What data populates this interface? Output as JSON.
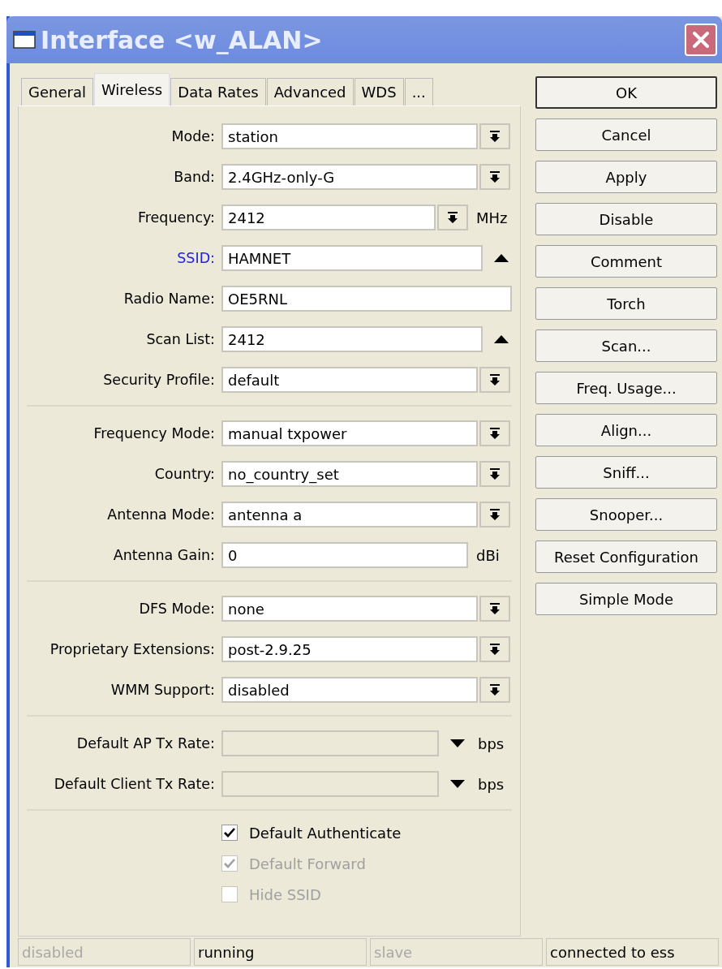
{
  "window": {
    "title": "Interface <w_ALAN>"
  },
  "tabs": [
    {
      "label": "General",
      "selected": false
    },
    {
      "label": "Wireless",
      "selected": true
    },
    {
      "label": "Data Rates",
      "selected": false
    },
    {
      "label": "Advanced",
      "selected": false
    },
    {
      "label": "WDS",
      "selected": false
    },
    {
      "label": "...",
      "selected": false
    }
  ],
  "sections": [
    {
      "fields": [
        {
          "label": "Mode:",
          "value": "station",
          "kind": "dropdown",
          "highlighted": false
        },
        {
          "label": "Band:",
          "value": "2.4GHz-only-G",
          "kind": "dropdown",
          "highlighted": false
        },
        {
          "label": "Frequency:",
          "value": "2412",
          "kind": "dropdown",
          "unit": "MHz",
          "highlighted": false
        },
        {
          "label": "SSID:",
          "value": "HAMNET",
          "kind": "list",
          "highlighted": true
        },
        {
          "label": "Radio Name:",
          "value": "OE5RNL",
          "kind": "text",
          "highlighted": false
        },
        {
          "label": "Scan List:",
          "value": "2412",
          "kind": "list",
          "highlighted": false
        },
        {
          "label": "Security Profile:",
          "value": "default",
          "kind": "dropdown",
          "highlighted": false
        }
      ]
    },
    {
      "fields": [
        {
          "label": "Frequency Mode:",
          "value": "manual txpower",
          "kind": "dropdown",
          "highlighted": false
        },
        {
          "label": "Country:",
          "value": "no_country_set",
          "kind": "dropdown",
          "highlighted": false
        },
        {
          "label": "Antenna Mode:",
          "value": "antenna a",
          "kind": "dropdown",
          "highlighted": false
        },
        {
          "label": "Antenna Gain:",
          "value": "0",
          "kind": "text",
          "unit": "dBi",
          "highlighted": false
        }
      ]
    },
    {
      "fields": [
        {
          "label": "DFS Mode:",
          "value": "none",
          "kind": "dropdown",
          "highlighted": false
        },
        {
          "label": "Proprietary Extensions:",
          "value": "post-2.9.25",
          "kind": "dropdown",
          "highlighted": false
        },
        {
          "label": "WMM Support:",
          "value": "disabled",
          "kind": "dropdown",
          "highlighted": false
        }
      ]
    },
    {
      "fields": [
        {
          "label": "Default AP Tx Rate:",
          "kind": "rate",
          "unit": "bps",
          "highlighted": false
        },
        {
          "label": "Default Client Tx Rate:",
          "kind": "rate",
          "unit": "bps",
          "highlighted": false
        }
      ]
    }
  ],
  "checkboxes": [
    {
      "label": "Default Authenticate",
      "checked": true,
      "disabled": false
    },
    {
      "label": "Default Forward",
      "checked": true,
      "disabled": true
    },
    {
      "label": "Hide SSID",
      "checked": false,
      "disabled": true
    }
  ],
  "button_groups": [
    {
      "buttons": [
        {
          "label": "OK",
          "default": true
        },
        {
          "label": "Cancel",
          "default": false
        },
        {
          "label": "Apply",
          "default": false
        }
      ]
    },
    {
      "buttons": [
        {
          "label": "Disable",
          "default": false
        },
        {
          "label": "Comment",
          "default": false
        }
      ]
    },
    {
      "buttons": [
        {
          "label": "Torch",
          "default": false
        },
        {
          "label": "Scan...",
          "default": false
        },
        {
          "label": "Freq. Usage...",
          "default": false
        },
        {
          "label": "Align...",
          "default": false
        },
        {
          "label": "Sniff...",
          "default": false
        },
        {
          "label": "Snooper...",
          "default": false
        }
      ]
    },
    {
      "buttons": [
        {
          "label": "Reset Configuration",
          "default": false
        }
      ]
    },
    {
      "buttons": [
        {
          "label": "Simple Mode",
          "default": false
        }
      ]
    }
  ],
  "status_bar": [
    {
      "text": "disabled",
      "disabled": true
    },
    {
      "text": "running",
      "disabled": false
    },
    {
      "text": "slave",
      "disabled": true
    },
    {
      "text": "connected to ess",
      "disabled": false
    }
  ]
}
